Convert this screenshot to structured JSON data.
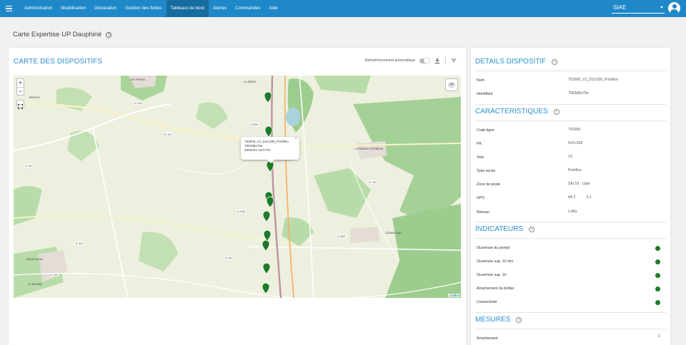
{
  "nav": {
    "items": [
      {
        "label": "Administration",
        "active": false
      },
      {
        "label": "Modélisation",
        "active": false
      },
      {
        "label": "Déclaration",
        "active": false
      },
      {
        "label": "Gestion des flottes",
        "active": false
      },
      {
        "label": "Tableaux de bord",
        "active": true
      },
      {
        "label": "Alertes",
        "active": false
      },
      {
        "label": "Commandes",
        "active": false
      },
      {
        "label": "Aide",
        "active": false
      }
    ],
    "organization": "SIAE"
  },
  "page": {
    "title": "Carte Expertise UP Dauphiné"
  },
  "map_card": {
    "title": "CARTE DES DISPOSITIFS",
    "auto_refresh_label": "Rafraîchissement automatique",
    "auto_refresh_on": false,
    "attribution": "Leaflet",
    "popup": {
      "name": "752000_V1_515.035_Portillon",
      "id": "70b3d5e75e",
      "datetime": "20/04/21 15:07:57"
    },
    "place_labels": [
      "Les Perses",
      "La Balme",
      "Moirenc",
      "La Baume-Cornillane",
      "Montmeyran",
      "Chatuzange",
      "Le Monteil"
    ],
    "road_labels": [
      "D 119",
      "D 142",
      "D 538",
      "D 120",
      "D 538",
      "D 745",
      "D 342",
      "D 538",
      "D 142",
      "D 125"
    ]
  },
  "details": {
    "title": "DETAILS DISPOSITIF",
    "rows": [
      {
        "label": "Nom",
        "value": "752000_V1_515.035_Portillon"
      },
      {
        "label": "Identifiant",
        "value": "70b3d5e75e"
      }
    ]
  },
  "caracteristiques": {
    "title": "CARACTÉRISTIQUES",
    "rows": [
      {
        "label": "Code ligne",
        "value": "752000"
      },
      {
        "label": "PK",
        "value": "515+035"
      },
      {
        "label": "Voie",
        "value": "V1"
      },
      {
        "label": "Type accès",
        "value": "Portillon"
      },
      {
        "label": "Zone de poste",
        "value": "SEI 52 : Upie"
      },
      {
        "label": "GPS",
        "value": "44.2          ,5.1"
      },
      {
        "label": "Réseau",
        "value": "LoRa"
      }
    ]
  },
  "indicateurs": {
    "title": "INDICATEURS",
    "status_color": "#1d7a28",
    "rows": [
      {
        "label": "Ouverture du portail"
      },
      {
        "label": "Ouverture sup. 10 min"
      },
      {
        "label": "Ouverture sup. 1h"
      },
      {
        "label": "Arrachement du boîtier"
      },
      {
        "label": "Connectivité"
      }
    ]
  },
  "mesures": {
    "title": "MESURES",
    "rows": [
      {
        "label": "Arrachement",
        "value": "1"
      }
    ]
  },
  "colors": {
    "nav_bar": "#1f88c8",
    "accent": "#2b8fd0",
    "marker": "#1d7a28"
  }
}
